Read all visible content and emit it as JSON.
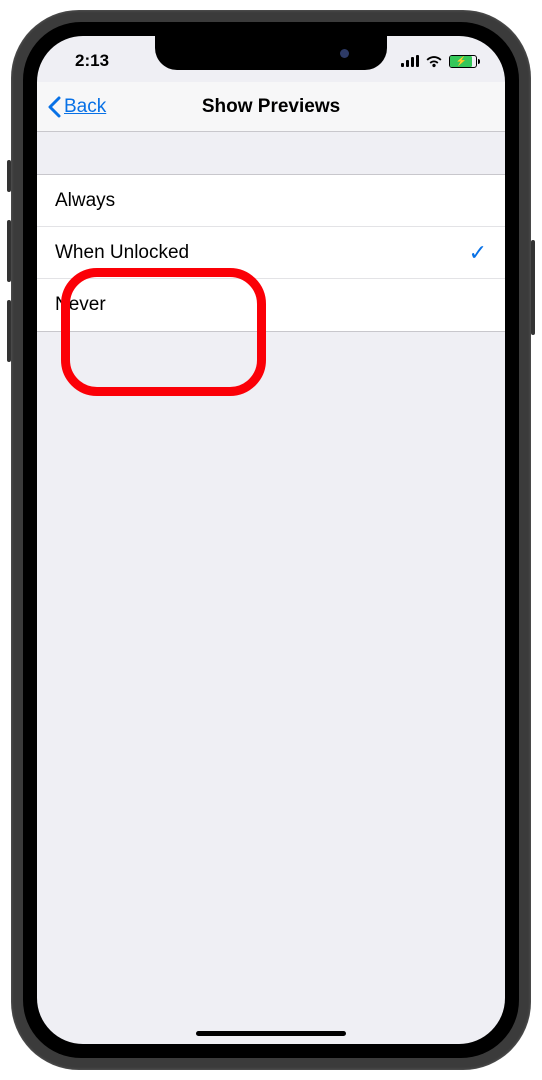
{
  "status": {
    "time": "2:13"
  },
  "nav": {
    "back_label": "Back",
    "title": "Show Previews"
  },
  "options": [
    {
      "label": "Always",
      "selected": false
    },
    {
      "label": "When Unlocked",
      "selected": true
    },
    {
      "label": "Never",
      "selected": false
    }
  ]
}
